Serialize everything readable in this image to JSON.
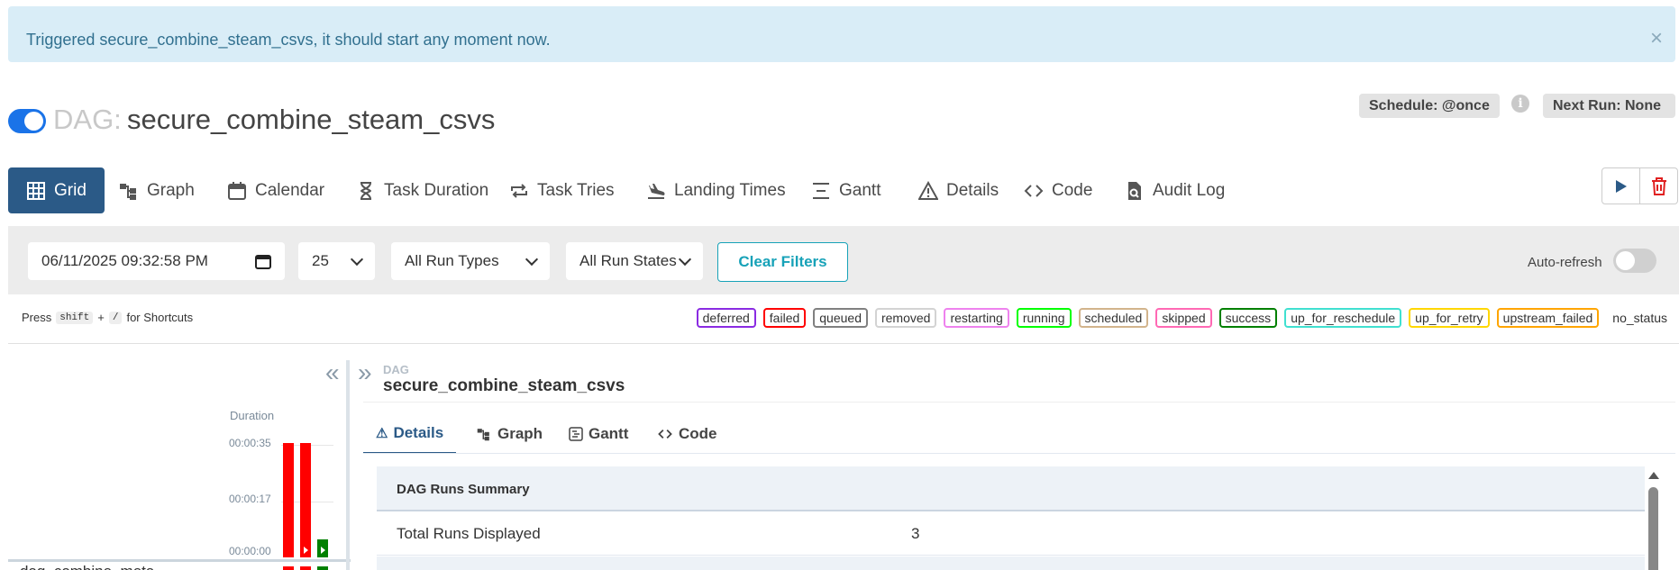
{
  "alert": {
    "text": "Triggered secure_combine_steam_csvs, it should start any moment now.",
    "close": "×"
  },
  "dag": {
    "prefix": "DAG:",
    "name": "secure_combine_steam_csvs",
    "enabled": true
  },
  "header": {
    "schedule": "Schedule: @once",
    "next_run": "Next Run: None",
    "info": "i"
  },
  "nav": [
    {
      "label": "Grid",
      "icon": "grid-icon"
    },
    {
      "label": "Graph",
      "icon": "graph-icon"
    },
    {
      "label": "Calendar",
      "icon": "calendar-icon"
    },
    {
      "label": "Task Duration",
      "icon": "hourglass-icon"
    },
    {
      "label": "Task Tries",
      "icon": "repeat-icon"
    },
    {
      "label": "Landing Times",
      "icon": "plane-landing-icon"
    },
    {
      "label": "Gantt",
      "icon": "gantt-icon"
    },
    {
      "label": "Details",
      "icon": "warning-icon"
    },
    {
      "label": "Code",
      "icon": "code-icon"
    },
    {
      "label": "Audit Log",
      "icon": "file-search-icon"
    }
  ],
  "filters": {
    "date": "06/11/2025 09:32:58 PM",
    "count": "25",
    "run_types": "All Run Types",
    "run_states": "All Run States",
    "clear": "Clear Filters",
    "auto_refresh": "Auto-refresh"
  },
  "shortcut": {
    "press": "Press",
    "key1": "shift",
    "plus": "+",
    "key2": "/",
    "suffix": "for Shortcuts"
  },
  "legend": [
    {
      "label": "deferred",
      "color": "#8a2be2"
    },
    {
      "label": "failed",
      "color": "#ff0000"
    },
    {
      "label": "queued",
      "color": "#808080"
    },
    {
      "label": "removed",
      "color": "#d3d3d3"
    },
    {
      "label": "restarting",
      "color": "#ee82ee"
    },
    {
      "label": "running",
      "color": "#00ff00"
    },
    {
      "label": "scheduled",
      "color": "#d2b48c"
    },
    {
      "label": "skipped",
      "color": "#ff69b4"
    },
    {
      "label": "success",
      "color": "#008000"
    },
    {
      "label": "up_for_reschedule",
      "color": "#40e0d0"
    },
    {
      "label": "up_for_retry",
      "color": "#ffd700"
    },
    {
      "label": "upstream_failed",
      "color": "#ffa500"
    },
    {
      "label": "no_status",
      "color": ""
    }
  ],
  "grid": {
    "duration_label": "Duration",
    "ticks": [
      "00:00:35",
      "00:00:17",
      "00:00:00"
    ],
    "runs": [
      {
        "state": "failed",
        "duration_s": 35
      },
      {
        "state": "failed",
        "duration_s": 35
      },
      {
        "state": "success",
        "duration_s": 4
      }
    ],
    "row_text": "dag_combine_meta"
  },
  "panel": {
    "breadcrumb_label": "DAG",
    "breadcrumb_title": "secure_combine_steam_csvs",
    "tabs": [
      {
        "label": "Details",
        "icon": "warning-icon"
      },
      {
        "label": "Graph",
        "icon": "graph-icon"
      },
      {
        "label": "Gantt",
        "icon": "gantt-icon"
      },
      {
        "label": "Code",
        "icon": "code-icon"
      }
    ],
    "summary_title": "DAG Runs Summary",
    "rows": [
      {
        "key": "Total Runs Displayed",
        "value": "3"
      }
    ]
  },
  "colors": {
    "primary": "#2b5a87",
    "alert_bg": "#d9edf7",
    "alert_text": "#31708f",
    "accent": "#17a2b8",
    "failed": "#ff0000",
    "success": "#008000"
  }
}
